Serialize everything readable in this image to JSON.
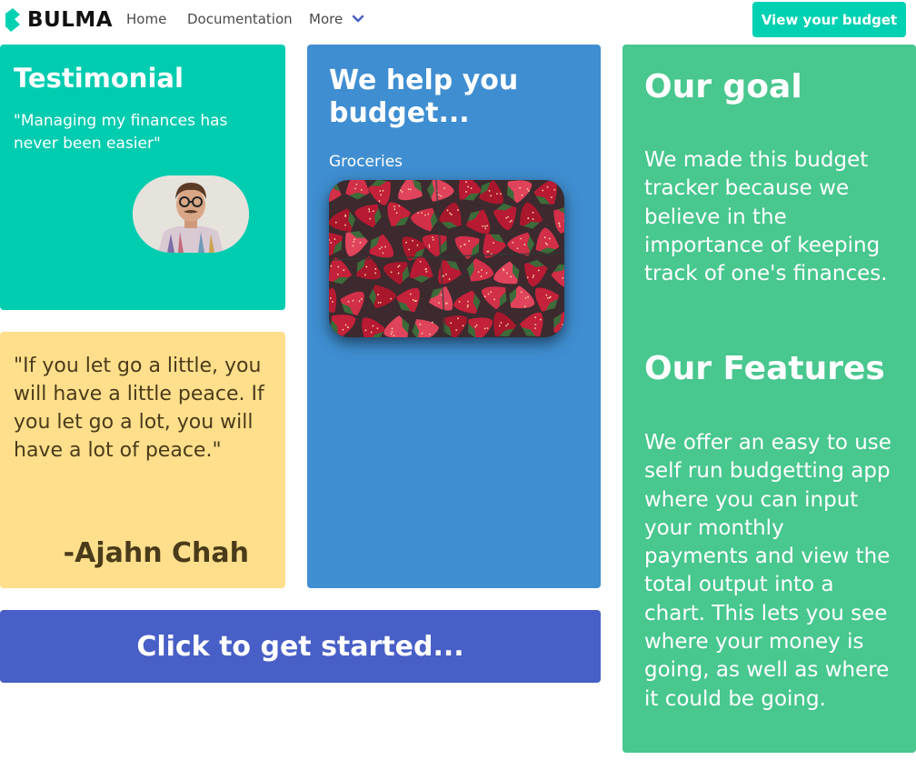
{
  "navbar": {
    "brand": "BULMA",
    "links": [
      "Home",
      "Documentation",
      "More"
    ],
    "cta_label": "View your budget"
  },
  "testimonial": {
    "title": "Testimonial",
    "text": "\"Managing my finances has never been easier\""
  },
  "quote": {
    "text": "\"If you let go a little, you will have a little peace. If you let go a lot, you will have a lot of peace.\"",
    "author": "-Ajahn Chah"
  },
  "help": {
    "title": "We help you budget...",
    "subtitle": "Groceries"
  },
  "goal": {
    "title": "Our goal",
    "text": "We made this budget tracker because we believe in the importance of keeping track of one's finances.",
    "features_title": "Our Features",
    "features_text": "We offer an easy to use self run budgetting app where you can input your monthly payments and view the total output into a chart. This lets you see where your money is going, as well as where it could be going."
  },
  "start": {
    "label": "Click to get started..."
  },
  "colors": {
    "primary": "#00d1b2",
    "info": "#3f8ed1",
    "success": "#48c78e",
    "warning": "#ffdf8c",
    "link": "#485fc7"
  }
}
